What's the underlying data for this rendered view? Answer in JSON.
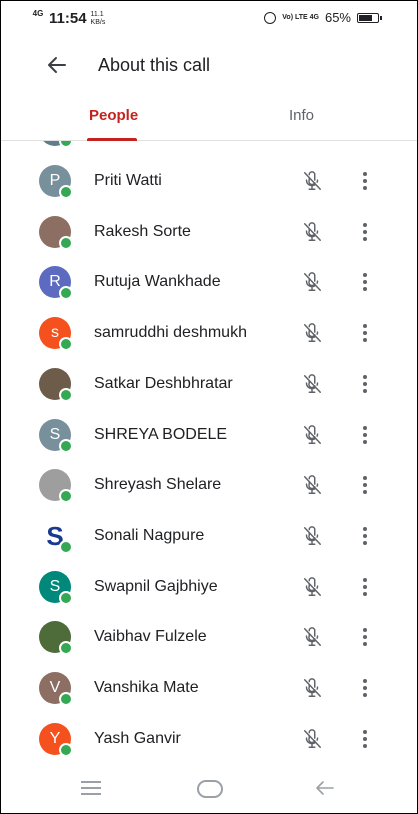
{
  "status_bar": {
    "network": "4G",
    "time": "11:54",
    "speed_value": "11.1",
    "speed_unit": "KB/s",
    "signal": "Vo) LTE 4G",
    "battery": "65%"
  },
  "header": {
    "title": "About this call"
  },
  "tabs": [
    {
      "label": "People",
      "active": true
    },
    {
      "label": "Info",
      "active": false
    }
  ],
  "participants": [
    {
      "name": "Priti Watti",
      "initial": "P",
      "color": "#78909c",
      "mic": "muted"
    },
    {
      "name": "Rakesh Sorte",
      "initial": "",
      "color": "#8d6e63",
      "mic": "muted"
    },
    {
      "name": "Rutuja Wankhade",
      "initial": "R",
      "color": "#5c6bc0",
      "mic": "muted"
    },
    {
      "name": "samruddhi deshmukh",
      "initial": "s",
      "color": "#f4511e",
      "mic": "muted"
    },
    {
      "name": "Satkar Deshbhratar",
      "initial": "",
      "color": "#6d5c4a",
      "mic": "muted"
    },
    {
      "name": "SHREYA BODELE",
      "initial": "S",
      "color": "#78909c",
      "mic": "muted"
    },
    {
      "name": "Shreyash Shelare",
      "initial": "",
      "color": "#9e9e9e",
      "mic": "muted"
    },
    {
      "name": "Sonali Nagpure",
      "initial": "S",
      "color": "#ffffff",
      "mic": "muted"
    },
    {
      "name": "Swapnil Gajbhiye",
      "initial": "S",
      "color": "#00897b",
      "mic": "muted"
    },
    {
      "name": "Vaibhav Fulzele",
      "initial": "",
      "color": "#4e6b3a",
      "mic": "muted"
    },
    {
      "name": "Vanshika Mate",
      "initial": "V",
      "color": "#8d6e63",
      "mic": "muted"
    },
    {
      "name": "Yash Ganvir",
      "initial": "Y",
      "color": "#f4511e",
      "mic": "muted"
    }
  ],
  "colors": {
    "accent": "#c5221f",
    "online": "#34a853"
  }
}
